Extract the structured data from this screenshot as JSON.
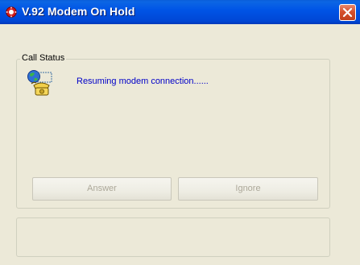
{
  "window": {
    "title": "V.92 Modem On Hold"
  },
  "call_status": {
    "group_label": "Call Status",
    "status_text": "Resuming modem connection......",
    "answer_label": "Answer",
    "ignore_label": "Ignore"
  },
  "icons": {
    "title": "modem-on-hold-icon",
    "status": "globe-telephone-icon",
    "close": "close-icon"
  },
  "colors": {
    "titlebar": "#0055e6",
    "status_text": "#0000c8",
    "disabled_text": "#aca899",
    "dialog_bg": "#ece9d8"
  }
}
